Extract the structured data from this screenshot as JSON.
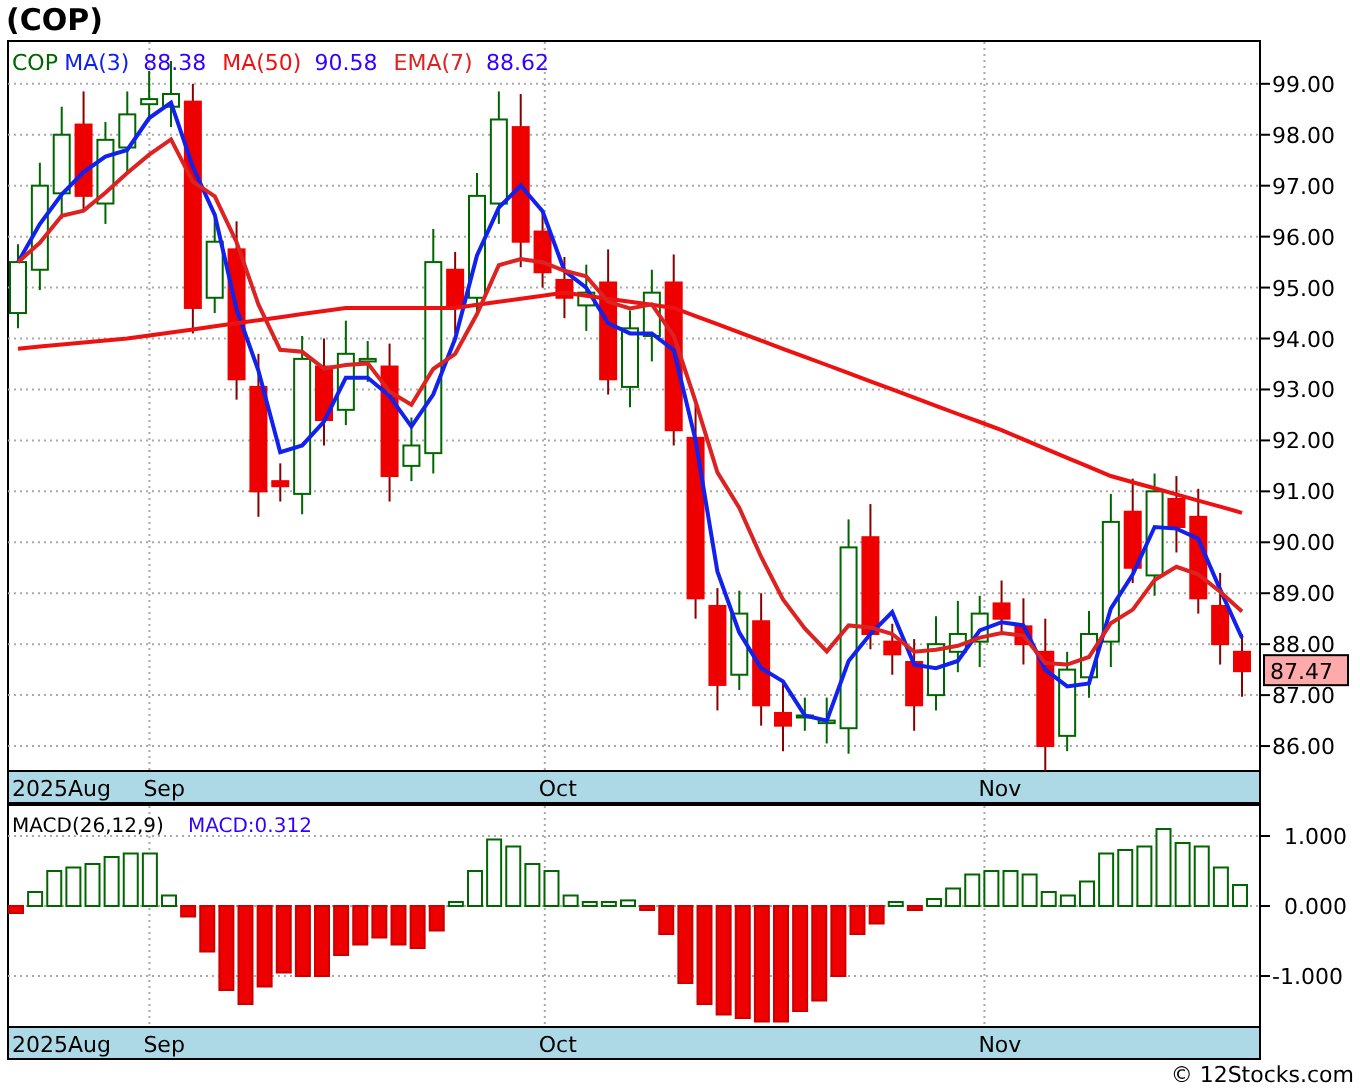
{
  "title": "(COP)",
  "price_panel": {
    "symbol": "COP",
    "readings": [
      "88.38",
      "90.58",
      "88.62"
    ],
    "last_price": "87.47",
    "date_labels": [
      "2025Aug",
      "Sep",
      "Oct",
      "Nov"
    ],
    "chart_data": {
      "type": "candlestick",
      "grid": true,
      "ylim": [
        85.53,
        99.86
      ],
      "yticks": [
        {
          "value": 86,
          "label": "86.00"
        },
        {
          "value": 87,
          "label": "87.00"
        },
        {
          "value": 88,
          "label": "88.00"
        },
        {
          "value": 89,
          "label": "89.00"
        },
        {
          "value": 90,
          "label": "90.00"
        },
        {
          "value": 91,
          "label": "91.00"
        },
        {
          "value": 92,
          "label": "92.00"
        },
        {
          "value": 93,
          "label": "93.00"
        },
        {
          "value": 94,
          "label": "94.00"
        },
        {
          "value": 95,
          "label": "95.00"
        },
        {
          "value": 96,
          "label": "96.00"
        },
        {
          "value": 97,
          "label": "97.00"
        },
        {
          "value": 98,
          "label": "98.00"
        },
        {
          "value": 99,
          "label": "99.00"
        }
      ],
      "ohlc": [
        [
          94.5,
          95.85,
          94.2,
          95.5
        ],
        [
          95.35,
          97.45,
          94.95,
          97.0
        ],
        [
          96.85,
          98.55,
          96.35,
          98.0
        ],
        [
          98.2,
          98.85,
          96.5,
          96.8
        ],
        [
          96.65,
          98.25,
          96.25,
          97.9
        ],
        [
          97.75,
          98.85,
          97.25,
          98.4
        ],
        [
          98.6,
          99.25,
          98.3,
          98.7
        ],
        [
          98.55,
          99.45,
          98.15,
          98.8
        ],
        [
          98.65,
          99.0,
          94.1,
          94.6
        ],
        [
          94.8,
          96.35,
          94.5,
          95.9
        ],
        [
          95.75,
          96.3,
          92.8,
          93.2
        ],
        [
          93.05,
          93.7,
          90.5,
          91.0
        ],
        [
          91.2,
          91.55,
          90.8,
          91.1
        ],
        [
          90.95,
          94.05,
          90.55,
          93.6
        ],
        [
          93.45,
          94.0,
          91.9,
          92.4
        ],
        [
          92.6,
          94.35,
          92.3,
          93.7
        ],
        [
          93.55,
          93.95,
          93.15,
          93.6
        ],
        [
          93.45,
          93.9,
          90.8,
          91.3
        ],
        [
          91.5,
          92.45,
          91.2,
          91.9
        ],
        [
          91.75,
          96.15,
          91.35,
          95.5
        ],
        [
          95.35,
          95.7,
          94.1,
          94.6
        ],
        [
          94.8,
          97.25,
          94.5,
          96.8
        ],
        [
          96.65,
          98.85,
          96.25,
          98.3
        ],
        [
          98.15,
          98.8,
          95.4,
          95.9
        ],
        [
          96.1,
          96.45,
          95.0,
          95.3
        ],
        [
          95.15,
          95.6,
          94.4,
          94.8
        ],
        [
          94.65,
          95.45,
          94.15,
          94.9
        ],
        [
          95.1,
          95.75,
          92.9,
          93.2
        ],
        [
          93.05,
          94.55,
          92.65,
          94.2
        ],
        [
          94.05,
          95.35,
          93.55,
          94.9
        ],
        [
          95.1,
          95.65,
          91.9,
          92.2
        ],
        [
          92.05,
          92.7,
          88.5,
          88.9
        ],
        [
          88.75,
          89.1,
          86.7,
          87.2
        ],
        [
          87.4,
          89.05,
          87.1,
          88.6
        ],
        [
          88.45,
          89.0,
          86.4,
          86.8
        ],
        [
          86.65,
          87.3,
          85.9,
          86.4
        ],
        [
          86.6,
          86.95,
          86.3,
          86.6
        ],
        [
          86.45,
          86.95,
          86.05,
          86.5
        ],
        [
          86.35,
          90.45,
          85.85,
          89.9
        ],
        [
          90.1,
          90.75,
          87.9,
          88.2
        ],
        [
          88.05,
          88.4,
          87.4,
          87.8
        ],
        [
          87.65,
          88.1,
          86.3,
          86.8
        ],
        [
          87.0,
          88.55,
          86.7,
          88.0
        ],
        [
          87.85,
          88.85,
          87.45,
          88.2
        ],
        [
          88.05,
          88.95,
          87.55,
          88.6
        ],
        [
          88.8,
          89.25,
          88.2,
          88.5
        ],
        [
          88.35,
          88.9,
          87.6,
          88.0
        ],
        [
          87.85,
          88.5,
          85.5,
          86.0
        ],
        [
          86.2,
          87.85,
          85.9,
          87.5
        ],
        [
          87.35,
          88.65,
          86.95,
          88.2
        ],
        [
          88.05,
          90.95,
          87.55,
          90.4
        ],
        [
          90.6,
          91.25,
          89.2,
          89.5
        ],
        [
          89.35,
          91.35,
          88.95,
          91.0
        ],
        [
          90.85,
          91.3,
          89.8,
          90.3
        ],
        [
          90.5,
          91.05,
          88.6,
          88.9
        ],
        [
          88.75,
          89.4,
          87.6,
          88.0
        ],
        [
          87.85,
          88.2,
          86.97,
          87.47
        ]
      ]
    },
    "studies": {
      "chart_data": {
        "type": "line",
        "ylim": [
          85.53,
          99.86
        ],
        "series": [
          {
            "name": "MA(3)",
            "color": "#1122ee",
            "values": [
              95.5,
              96.25,
              96.83,
              97.27,
              97.57,
              97.7,
              98.33,
              98.63,
              97.37,
              96.43,
              94.57,
              93.37,
              91.77,
              91.9,
              92.37,
              93.23,
              93.23,
              92.87,
              92.27,
              92.9,
              94.0,
              95.63,
              96.57,
              97.0,
              96.5,
              95.33,
              95.0,
              94.3,
              94.1,
              94.1,
              93.77,
              92.0,
              89.43,
              88.23,
              87.53,
              87.27,
              86.6,
              86.5,
              87.67,
              88.2,
              88.63,
              87.6,
              87.53,
              87.67,
              88.27,
              88.43,
              88.37,
              87.5,
              87.17,
              87.23,
              88.7,
              89.37,
              90.3,
              90.27,
              90.07,
              89.07,
              88.12
            ]
          },
          {
            "name": "MA(50)",
            "color": "#ee1111",
            "values": [
              93.8,
              93.84,
              93.88,
              93.92,
              93.96,
              94.0,
              94.06,
              94.12,
              94.18,
              94.24,
              94.3,
              94.36,
              94.42,
              94.48,
              94.54,
              94.6,
              94.6,
              94.6,
              94.6,
              94.6,
              94.6,
              94.66,
              94.72,
              94.78,
              94.84,
              94.9,
              94.84,
              94.78,
              94.72,
              94.66,
              94.6,
              94.44,
              94.28,
              94.12,
              93.96,
              93.8,
              93.64,
              93.48,
              93.32,
              93.16,
              93.0,
              92.84,
              92.68,
              92.52,
              92.36,
              92.2,
              92.02,
              91.84,
              91.66,
              91.48,
              91.3,
              91.18,
              91.06,
              90.94,
              90.82,
              90.7,
              90.58
            ]
          },
          {
            "name": "EMA(7)",
            "color": "#dd2222",
            "values": [
              95.5,
              95.88,
              96.41,
              96.51,
              96.86,
              97.25,
              97.61,
              97.91,
              97.08,
              96.79,
              95.89,
              94.67,
              93.78,
              93.74,
              93.41,
              93.48,
              93.51,
              92.96,
              92.7,
              93.4,
              93.7,
              94.48,
              95.44,
              95.56,
              95.5,
              95.33,
              95.22,
              94.72,
              94.59,
              94.67,
              94.05,
              92.76,
              91.37,
              90.68,
              89.71,
              88.88,
              88.31,
              87.86,
              88.37,
              88.33,
              88.2,
              87.85,
              87.89,
              87.97,
              88.13,
              88.22,
              88.17,
              87.63,
              87.6,
              87.75,
              88.41,
              88.68,
              89.26,
              89.52,
              89.37,
              89.03,
              88.64
            ]
          }
        ]
      }
    }
  },
  "macd_panel": {
    "legend": [
      {
        "text": "MACD(26,12,9)",
        "kind": "name"
      },
      {
        "text": "MACD:0.312",
        "kind": "value"
      }
    ],
    "date_labels": [
      "2025Aug",
      "Sep",
      "Oct",
      "Nov"
    ],
    "chart_data": {
      "type": "bar",
      "grid": true,
      "ylim": [
        -1.714,
        1.457
      ],
      "yticks": [
        {
          "value": -1,
          "label": "-1.000"
        },
        {
          "value": 0,
          "label": "0.000"
        },
        {
          "value": 1,
          "label": "1.000"
        }
      ],
      "values": [
        -0.1,
        0.2,
        0.5,
        0.55,
        0.6,
        0.7,
        0.75,
        0.75,
        0.15,
        -0.15,
        -0.65,
        -1.2,
        -1.4,
        -1.15,
        -0.95,
        -1.0,
        -1.0,
        -0.7,
        -0.55,
        -0.45,
        -0.55,
        -0.6,
        -0.35,
        0.05,
        0.5,
        0.95,
        0.85,
        0.6,
        0.5,
        0.15,
        0.05,
        0.05,
        0.08,
        -0.05,
        -0.4,
        -1.1,
        -1.4,
        -1.55,
        -1.6,
        -1.65,
        -1.65,
        -1.5,
        -1.35,
        -1.0,
        -0.4,
        -0.25,
        0.02,
        -0.05,
        0.1,
        0.25,
        0.45,
        0.5,
        0.5,
        0.45,
        0.2,
        0.15,
        0.35,
        0.75,
        0.8,
        0.85,
        1.1,
        0.9,
        0.85,
        0.55,
        0.3
      ]
    }
  },
  "footer": "© 12Stocks.com"
}
